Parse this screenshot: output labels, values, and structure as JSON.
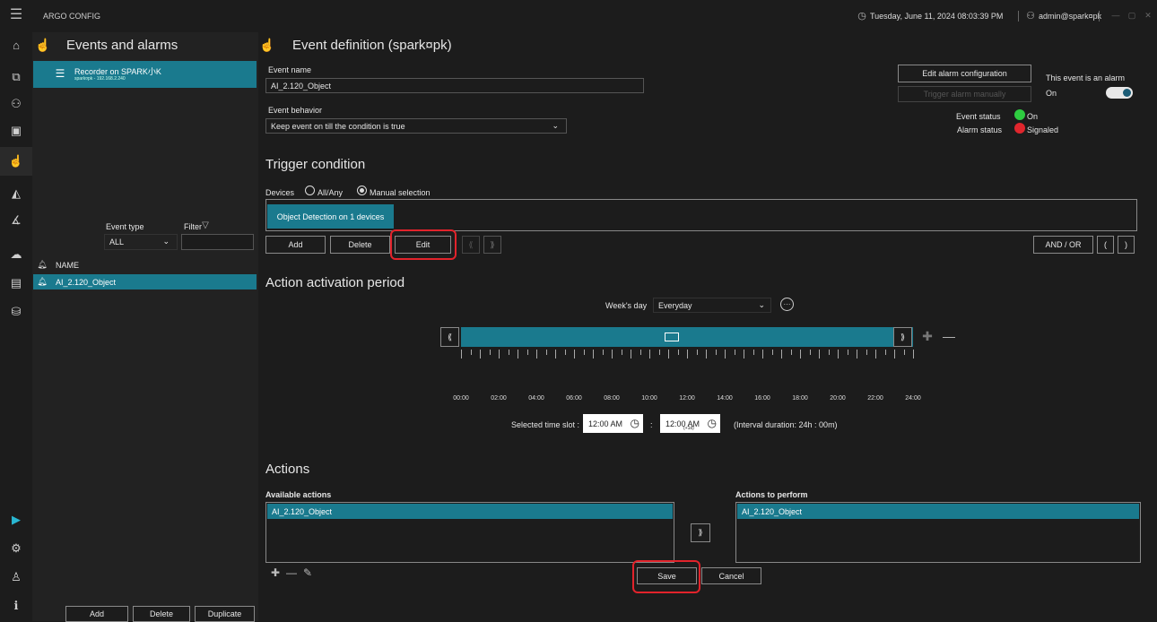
{
  "titlebar": {
    "app_title": "ARGO CONFIG",
    "datetime": "Tuesday, June 11, 2024 08:03:39 PM",
    "user": "admin@spark¤pk"
  },
  "left_panel": {
    "title": "Events and alarms",
    "recorder_name": "Recorder on SPARK小K",
    "recorder_sub": "spark¤pk - 192.168.2.240",
    "event_type_label": "Event type",
    "event_type_value": "ALL",
    "filter_label": "Filter",
    "filter_value": "",
    "list_header": "NAME",
    "events": [
      "AI_2.120_Object"
    ],
    "buttons": {
      "add": "Add",
      "delete": "Delete",
      "duplicate": "Duplicate"
    }
  },
  "event_def": {
    "title": "Event definition (spark¤pk)",
    "event_name_label": "Event name",
    "event_name_value": "AI_2.120_Object",
    "behavior_label": "Event behavior",
    "behavior_value": "Keep event on till the condition is true",
    "edit_alarm_btn": "Edit alarm configuration",
    "trigger_alarm_btn": "Trigger alarm manually",
    "is_alarm_label": "This event is an alarm",
    "is_alarm_state": "On",
    "event_status_label": "Event status",
    "event_status_value": "On",
    "event_status_color": "#2ecc40",
    "alarm_status_label": "Alarm status",
    "alarm_status_value": "Signaled",
    "alarm_status_color": "#e0262d"
  },
  "trigger": {
    "title": "Trigger condition",
    "devices_label": "Devices",
    "opt_all": "All/Any",
    "opt_manual": "Manual selection",
    "selected_option": "Manual selection",
    "condition_item": "Object Detection on 1 devices",
    "buttons": {
      "add": "Add",
      "delete": "Delete",
      "edit": "Edit",
      "and_or": "AND / OR",
      "open_paren": "(",
      "close_paren": ")"
    }
  },
  "activation": {
    "title": "Action activation period",
    "weekday_label": "Week's day",
    "weekday_value": "Everyday",
    "hours": [
      "00:00",
      "02:00",
      "04:00",
      "06:00",
      "08:00",
      "10:00",
      "12:00",
      "14:00",
      "16:00",
      "18:00",
      "20:00",
      "22:00",
      "24:00"
    ],
    "slot_label": "Selected time slot :",
    "slot_start": "12:00 AM",
    "slot_end": "12:00 AM",
    "slot_end_note": "(+1d)",
    "interval": "(Interval duration:  24h : 00m)"
  },
  "actions": {
    "title": "Actions",
    "available_label": "Available actions",
    "available": [
      "AI_2.120_Object"
    ],
    "perform_label": "Actions to perform",
    "perform": [
      "AI_2.120_Object"
    ]
  },
  "footer": {
    "save": "Save",
    "cancel": "Cancel"
  }
}
